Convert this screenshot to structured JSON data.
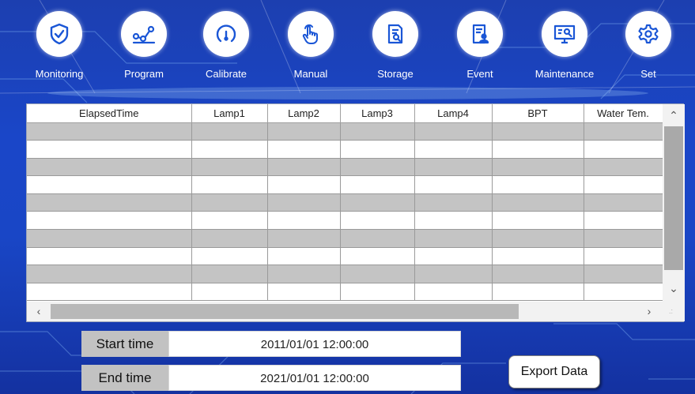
{
  "nav": {
    "items": [
      {
        "label": "Monitoring",
        "icon": "shield-check-icon"
      },
      {
        "label": "Program",
        "icon": "line-graph-icon"
      },
      {
        "label": "Calibrate",
        "icon": "gauge-icon"
      },
      {
        "label": "Manual",
        "icon": "hand-pointer-icon"
      },
      {
        "label": "Storage",
        "icon": "document-search-icon"
      },
      {
        "label": "Event",
        "icon": "document-user-icon"
      },
      {
        "label": "Maintenance",
        "icon": "monitor-wrench-icon"
      },
      {
        "label": "Set",
        "icon": "gear-icon"
      }
    ],
    "icon_color": "#1a56d6"
  },
  "table": {
    "columns": [
      "ElapsedTime",
      "Lamp1",
      "Lamp2",
      "Lamp3",
      "Lamp4",
      "BPT",
      "Water Tem."
    ],
    "row_count": 10,
    "rows": []
  },
  "filters": {
    "start_label": "Start time",
    "start_value": "2011/01/01 12:00:00",
    "end_label": "End time",
    "end_value": "2021/01/01 12:00:00"
  },
  "actions": {
    "export_label": "Export Data"
  },
  "colors": {
    "background": "#1a46c8",
    "row_gray": "#c4c4c4",
    "row_white": "#ffffff"
  }
}
